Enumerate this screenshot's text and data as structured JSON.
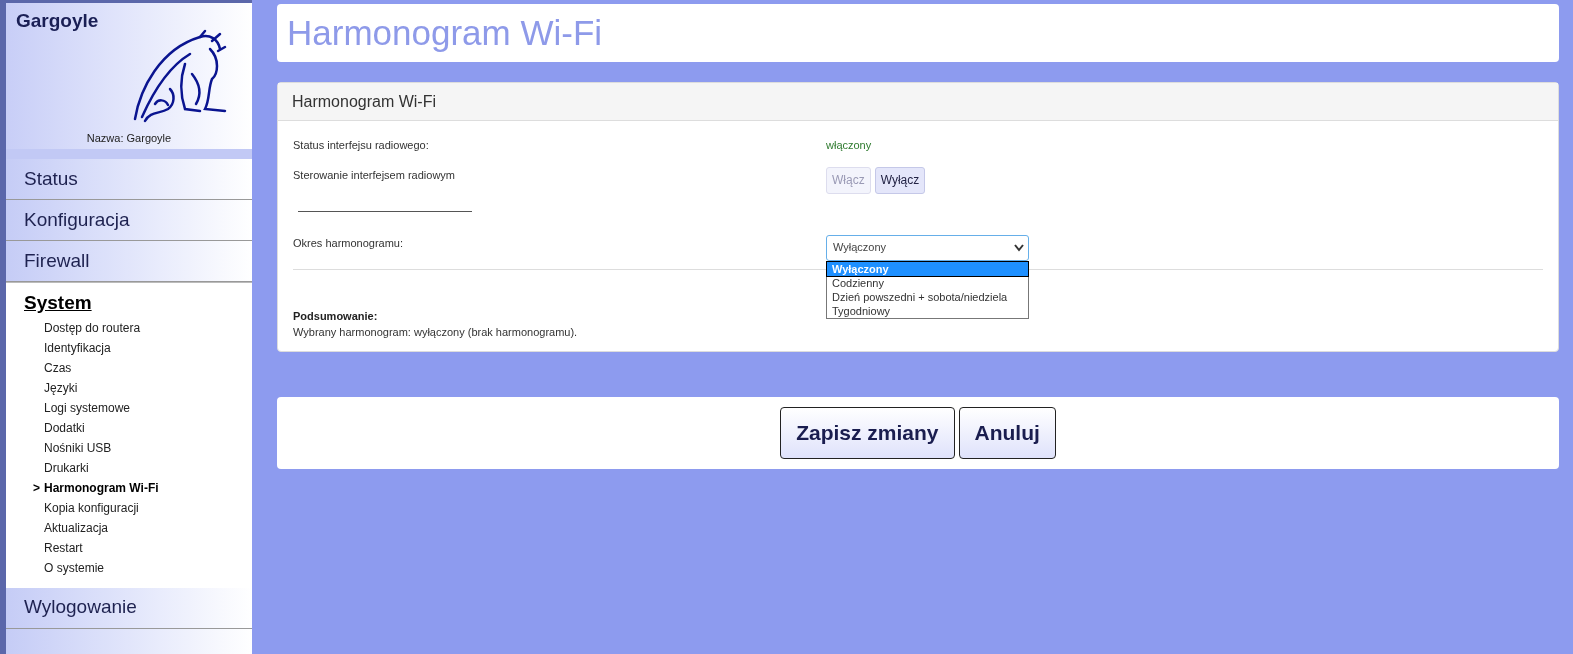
{
  "sidebar": {
    "title": "Gargoyle",
    "name_label": "Nazwa: Gargoyle",
    "menu": [
      {
        "label": "Status",
        "selected": false
      },
      {
        "label": "Konfiguracja",
        "selected": false
      },
      {
        "label": "Firewall",
        "selected": false
      },
      {
        "label": "System",
        "selected": true,
        "children": [
          {
            "label": "Dostęp do routera",
            "selected": false
          },
          {
            "label": "Identyfikacja",
            "selected": false
          },
          {
            "label": "Czas",
            "selected": false
          },
          {
            "label": "Języki",
            "selected": false
          },
          {
            "label": "Logi systemowe",
            "selected": false
          },
          {
            "label": "Dodatki",
            "selected": false
          },
          {
            "label": "Nośniki USB",
            "selected": false
          },
          {
            "label": "Drukarki",
            "selected": false
          },
          {
            "label": "Harmonogram Wi-Fi",
            "selected": true,
            "marker": ">"
          },
          {
            "label": "Kopia konfiguracji",
            "selected": false
          },
          {
            "label": "Aktualizacja",
            "selected": false
          },
          {
            "label": "Restart",
            "selected": false
          },
          {
            "label": "O systemie",
            "selected": false
          }
        ]
      },
      {
        "label": "Wylogowanie",
        "selected": false
      }
    ]
  },
  "page_title": "Harmonogram Wi-Fi",
  "panel": {
    "heading": "Harmonogram Wi-Fi",
    "status_label": "Status interfejsu radiowego:",
    "status_value": "włączony",
    "control_label": "Sterowanie interfejsem radiowym",
    "control_buttons": [
      {
        "label": "Włącz",
        "disabled": true
      },
      {
        "label": "Wyłącz",
        "disabled": false
      }
    ],
    "period_label": "Okres harmonogramu:",
    "period_select": {
      "value": "Wyłączony",
      "expanded": true,
      "options": [
        {
          "label": "Wyłączony",
          "selected": true
        },
        {
          "label": "Codzienny",
          "selected": false
        },
        {
          "label": "Dzień powszedni + sobota/niedziela",
          "selected": false
        },
        {
          "label": "Tygodniowy",
          "selected": false
        }
      ]
    },
    "summary_title": "Podsumowanie:",
    "summary_text": "Wybrany harmonogram: wyłączony (brak harmonogramu)."
  },
  "actions": [
    "Zapisz zmiany",
    "Anuluj"
  ]
}
